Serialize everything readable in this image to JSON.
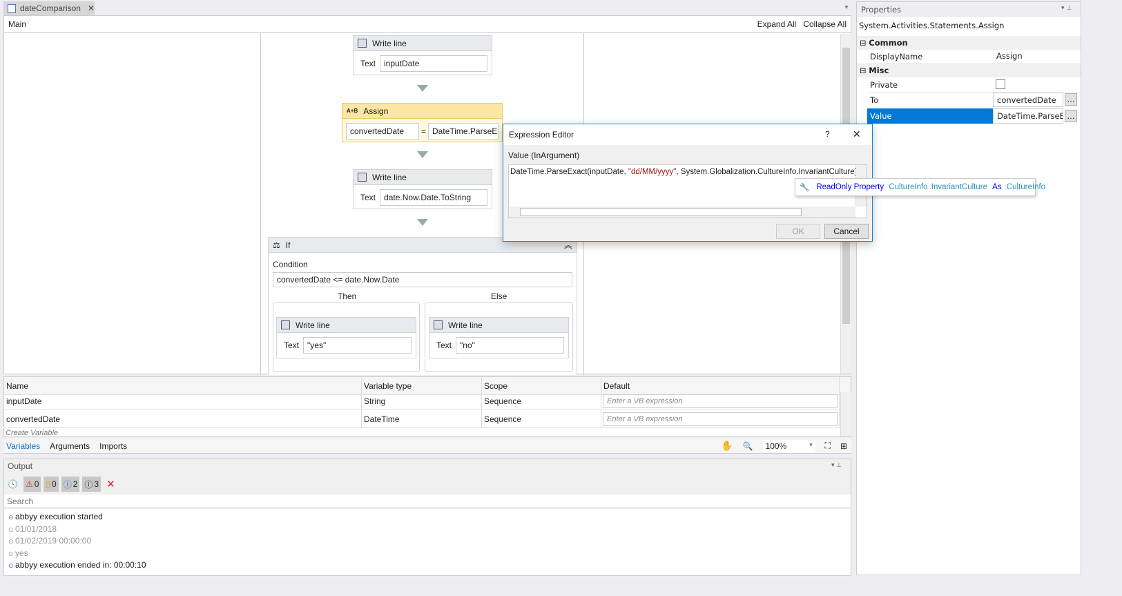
{
  "document_tab": {
    "label": "dateComparison",
    "close": "✕"
  },
  "designer": {
    "breadcrumb": "Main",
    "expand_all": "Expand All",
    "collapse_all": "Collapse All"
  },
  "activities": {
    "writeline1": {
      "title": "Write line",
      "label": "Text",
      "value": "inputDate"
    },
    "assign": {
      "icon": "A+B",
      "title": "Assign",
      "to": "convertedDate",
      "eq": "=",
      "value": "DateTime.ParseExa"
    },
    "writeline2": {
      "title": "Write line",
      "label": "Text",
      "value": "date.Now.Date.ToString"
    },
    "if": {
      "title": "If",
      "condition_label": "Condition",
      "condition": "convertedDate <= date.Now.Date",
      "then": "Then",
      "else": "Else",
      "then_writeline": {
        "title": "Write line",
        "label": "Text",
        "value": "\"yes\""
      },
      "else_writeline": {
        "title": "Write line",
        "label": "Text",
        "value": "\"no\""
      }
    }
  },
  "variables": {
    "columns": [
      "Name",
      "Variable type",
      "Scope",
      "Default"
    ],
    "rows": [
      {
        "name": "inputDate",
        "type": "String",
        "scope": "Sequence",
        "default_placeholder": "Enter a VB expression"
      },
      {
        "name": "convertedDate",
        "type": "DateTime",
        "scope": "Sequence",
        "default_placeholder": "Enter a VB expression"
      }
    ],
    "create": "Create Variable"
  },
  "bottom_tabs": [
    "Variables",
    "Arguments",
    "Imports"
  ],
  "zoom": "100%",
  "output": {
    "title": "Output",
    "counts": {
      "errors": "0",
      "warnings": "0",
      "info": "2",
      "trace": "3"
    },
    "search_placeholder": "Search",
    "lines": [
      {
        "text": "abbyy execution started",
        "dim": false
      },
      {
        "text": "01/01/2018",
        "dim": true
      },
      {
        "text": "01/02/2019 00:00:00",
        "dim": true
      },
      {
        "text": "yes",
        "dim": true
      },
      {
        "text": "abbyy execution ended in: 00:00:10",
        "dim": false
      }
    ]
  },
  "properties": {
    "title": "Properties",
    "type": "System.Activities.Statements.Assign",
    "cat_common": "Common",
    "cat_misc": "Misc",
    "displayname_label": "DisplayName",
    "displayname": "Assign",
    "private_label": "Private",
    "to_label": "To",
    "to": "convertedDate",
    "value_label": "Value",
    "value": "DateTime.ParseExa",
    "ellipsis": "..."
  },
  "dialog": {
    "title": "Expression Editor",
    "help": "?",
    "close": "✕",
    "label": "Value (InArgument)",
    "expr_a": "DateTime.ParseExact(inputDate, ",
    "expr_str": "\"dd/MM/yyyy\"",
    "expr_b": ", System.Globalization.CultureInfo.InvariantCulture)",
    "ok": "OK",
    "cancel": "Cancel"
  },
  "tooltip": {
    "kw1": "ReadOnly Property",
    "type1": "CultureInfo",
    "member": ".InvariantCulture",
    "kw2": "As",
    "type2": "CultureInfo"
  },
  "colors": {
    "accent": "#0078d7",
    "assign_header": "#fbe6a2",
    "string_literal": "#a31515",
    "keyword": "#0000ff",
    "type": "#2b91af"
  }
}
